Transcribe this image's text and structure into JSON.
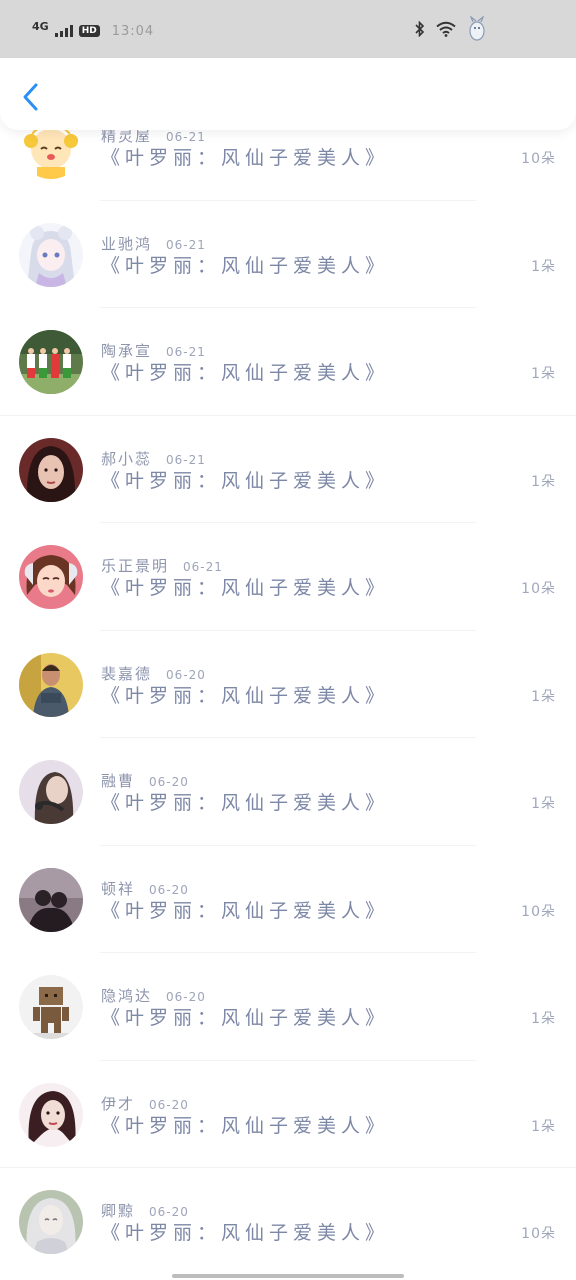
{
  "status_bar": {
    "network": "4G",
    "hd_badge": "HD",
    "time": "13:04"
  },
  "header": {
    "back_icon": "chevron-left-icon",
    "accent_color": "#2b8ff5"
  },
  "gift_list": [
    {
      "name": "精灵屋",
      "date": "06-21",
      "gift": "《叶罗丽：风仙子爱美人》",
      "count": "10朵",
      "avatar": "cartoon-girl"
    },
    {
      "name": "业驰鸿",
      "date": "06-21",
      "gift": "《叶罗丽：风仙子爱美人》",
      "count": "1朵",
      "avatar": "anime-girl"
    },
    {
      "name": "陶承宣",
      "date": "06-21",
      "gift": "《叶罗丽：风仙子爱美人》",
      "count": "1朵",
      "avatar": "group-photo"
    },
    {
      "name": "郝小蕊",
      "date": "06-21",
      "gift": "《叶罗丽：风仙子爱美人》",
      "count": "1朵",
      "avatar": "girl-portrait"
    },
    {
      "name": "乐正景明",
      "date": "06-21",
      "gift": "《叶罗丽：风仙子爱美人》",
      "count": "10朵",
      "avatar": "game-character"
    },
    {
      "name": "裴嘉德",
      "date": "06-20",
      "gift": "《叶罗丽：风仙子爱美人》",
      "count": "1朵",
      "avatar": "man-photo"
    },
    {
      "name": "融曹",
      "date": "06-20",
      "gift": "《叶罗丽：风仙子爱美人》",
      "count": "1朵",
      "avatar": "girl-headphones"
    },
    {
      "name": "顿祥",
      "date": "06-20",
      "gift": "《叶罗丽：风仙子爱美人》",
      "count": "10朵",
      "avatar": "couple-silhouette"
    },
    {
      "name": "隐鸿达",
      "date": "06-20",
      "gift": "《叶罗丽：风仙子爱美人》",
      "count": "1朵",
      "avatar": "box-robot"
    },
    {
      "name": "伊才",
      "date": "06-20",
      "gift": "《叶罗丽：风仙子爱美人》",
      "count": "1朵",
      "avatar": "girl-dark-hair"
    },
    {
      "name": "卿黥",
      "date": "06-20",
      "gift": "《叶罗丽：风仙子爱美人》",
      "count": "10朵",
      "avatar": "white-hair-girl"
    }
  ]
}
